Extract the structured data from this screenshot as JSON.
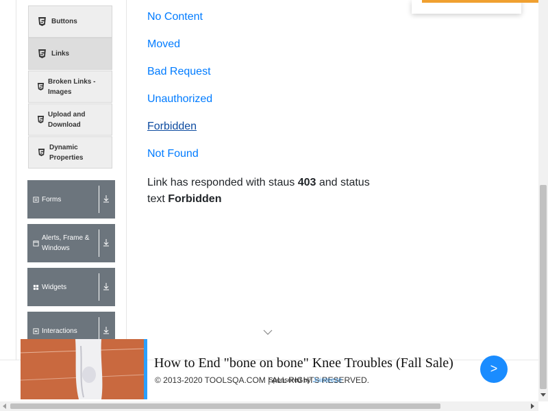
{
  "sidebar": {
    "subitems": [
      {
        "label": "Buttons"
      },
      {
        "label": "Links"
      },
      {
        "label": "Broken Links - Images"
      },
      {
        "label": "Upload and Download"
      },
      {
        "label": "Dynamic Properties"
      }
    ],
    "groups": [
      {
        "label": "Forms",
        "icon": "form-icon"
      },
      {
        "label": "Alerts, Frame & Windows",
        "icon": "window-icon"
      },
      {
        "label": "Widgets",
        "icon": "widgets-icon"
      },
      {
        "label": "Interactions",
        "icon": "interactions-icon"
      }
    ]
  },
  "links": [
    {
      "label": "No Content"
    },
    {
      "label": "Moved"
    },
    {
      "label": "Bad Request"
    },
    {
      "label": "Unauthorized"
    },
    {
      "label": "Forbidden"
    },
    {
      "label": "Not Found"
    }
  ],
  "response": {
    "prefix": "Link has responded with staus",
    "status_code": "403",
    "middle": "and status text",
    "status_text": "Forbidden"
  },
  "footer": {
    "copyright": "© 2013-2020 TOOLSQA.COM | ALL RIGHTS RESERVED."
  },
  "ad": {
    "headline": "How to End \"bone on bone\" Knee Troubles (Fall Sale)",
    "sponsored_prefix": "Sponsored by",
    "sponsor": "Jointeeze",
    "next_label": ">"
  },
  "colors": {
    "link": "#007bff",
    "visited_link": "#0d4ba0",
    "sidebar_group_bg": "#6c757d",
    "ad_button": "#1a8cff"
  }
}
